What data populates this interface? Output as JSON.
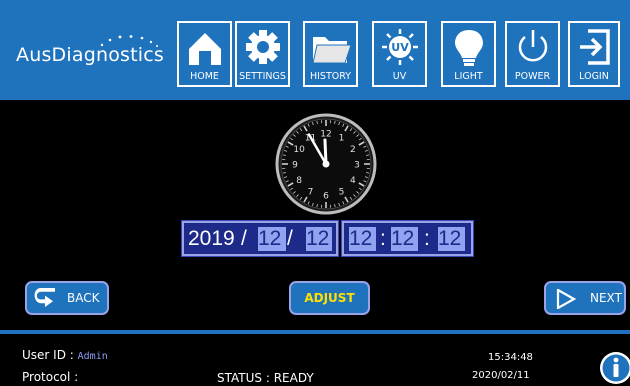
{
  "header": {
    "logo_text": "AusDiagnostics",
    "nav": [
      {
        "label": "HOME",
        "icon": "home-icon"
      },
      {
        "label": "SETTINGS",
        "icon": "gear-icon"
      },
      {
        "label": "HISTORY",
        "icon": "folder-icon"
      },
      {
        "label": "UV",
        "icon": "uv-icon",
        "icon_text": "UV"
      },
      {
        "label": "LIGHT",
        "icon": "lightbulb-icon"
      },
      {
        "label": "POWER",
        "icon": "power-icon"
      },
      {
        "label": "LOGIN",
        "icon": "login-icon"
      }
    ]
  },
  "clock": {
    "numbers": [
      "12",
      "1",
      "2",
      "3",
      "4",
      "5",
      "6",
      "7",
      "8",
      "9",
      "10",
      "11"
    ],
    "hour": 11,
    "minute": 55
  },
  "datetime": {
    "year": "2019",
    "month": "12",
    "day": "12",
    "hour": "12",
    "minute": "12",
    "second": "12",
    "date_sep": "/",
    "time_sep": ":"
  },
  "actions": {
    "back_label": "BACK",
    "adjust_label": "ADJUST",
    "next_label": "NEXT"
  },
  "footer": {
    "user_label": "User ID :",
    "user_value": "Admin",
    "protocol_label": "Protocol :",
    "status_label": "STATUS : READY",
    "time": "15:34:48",
    "date": "2020/02/11"
  },
  "colors": {
    "brand_blue": "#1f73bd",
    "field_bg": "#1d2a8a",
    "field_selected": "#8fa3f0",
    "adjust_text": "#ffe000"
  }
}
